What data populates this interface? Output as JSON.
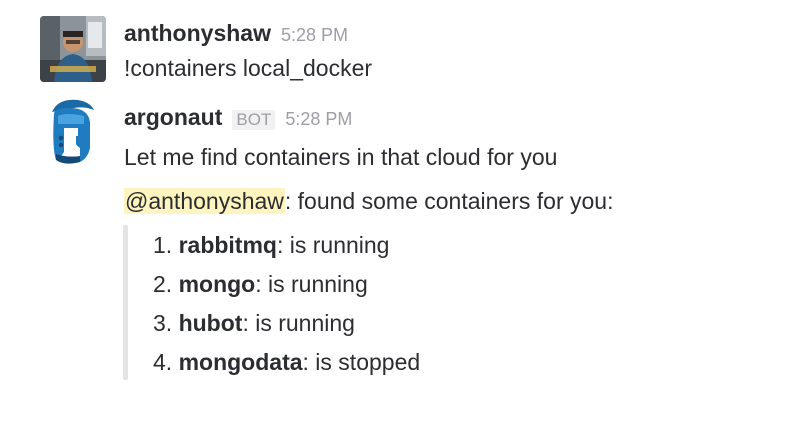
{
  "messages": [
    {
      "username": "anthonyshaw",
      "time": "5:28 PM",
      "text": "!containers local_docker",
      "avatar_icon": "user-photo"
    },
    {
      "username": "argonaut",
      "badge": "BOT",
      "time": "5:28 PM",
      "intro": "Let me find containers in that cloud for you",
      "mention": "@anthonyshaw",
      "mention_suffix": ": found some containers for you:",
      "avatar_icon": "spartan-helmet-icon"
    }
  ],
  "containers": [
    {
      "num": "1.",
      "name": "rabbitmq",
      "status": ": is running"
    },
    {
      "num": "2.",
      "name": "mongo",
      "status": ": is running"
    },
    {
      "num": "3.",
      "name": "hubot",
      "status": ": is running"
    },
    {
      "num": "4.",
      "name": "mongodata",
      "status": ": is stopped"
    }
  ],
  "colors": {
    "mention_bg": "#fdf4c0",
    "helmet_blue": "#1b6aa5",
    "quote_bar": "#e3e3e3"
  }
}
